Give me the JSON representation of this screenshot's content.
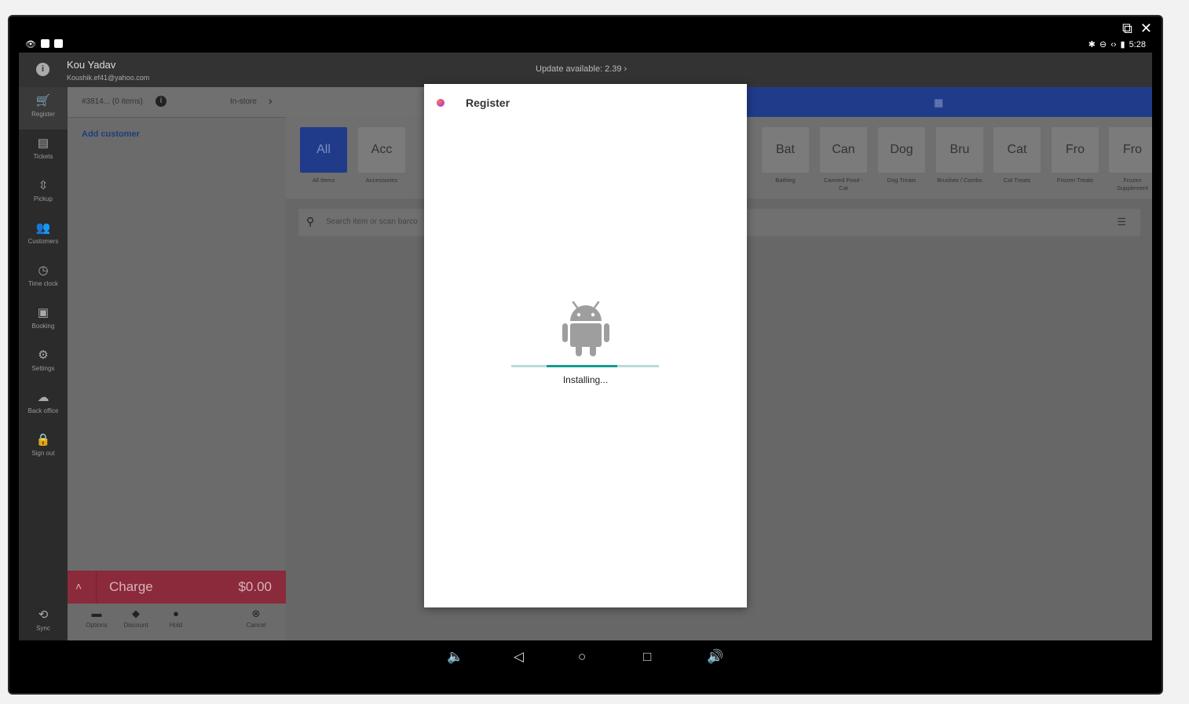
{
  "window": {
    "popout_icon": "popout-icon",
    "close_icon": "close-icon"
  },
  "statusbar": {
    "time": "5:28"
  },
  "header": {
    "user_name": "Kou Yadav",
    "user_email": "Koushik.ef41@yahoo.com",
    "update_text": "Update available: 2.39 ›"
  },
  "sidebar": {
    "items": [
      {
        "label": "Register",
        "icon": "🛒"
      },
      {
        "label": "Tickets",
        "icon": "▤"
      },
      {
        "label": "Pickup",
        "icon": "⇳"
      },
      {
        "label": "Customers",
        "icon": "👥"
      },
      {
        "label": "Time clock",
        "icon": "◷"
      },
      {
        "label": "Booking",
        "icon": "▣"
      },
      {
        "label": "Settings",
        "icon": "⚙"
      },
      {
        "label": "Back office",
        "icon": "☁"
      },
      {
        "label": "Sign out",
        "icon": "🔒"
      }
    ],
    "sync_label": "Sync"
  },
  "order": {
    "number": "#3814... (0 items)",
    "mode": "In-store",
    "add_customer": "Add customer",
    "charge_label": "Charge",
    "charge_amount": "$0.00",
    "actions": [
      {
        "label": "Options"
      },
      {
        "label": "Discount"
      },
      {
        "label": "Hold"
      },
      {
        "label": "Cancel"
      }
    ]
  },
  "categories": [
    {
      "tile": "All",
      "label": "All Items"
    },
    {
      "tile": "Acc",
      "label": "Accessories"
    },
    {
      "tile": "Bat",
      "label": "Bathing"
    },
    {
      "tile": "Can",
      "label": "Canned Food - Cat"
    },
    {
      "tile": "Dog",
      "label": "Dog Treats"
    },
    {
      "tile": "Bru",
      "label": "Brushes / Combs"
    },
    {
      "tile": "Cat",
      "label": "Cat Treats"
    },
    {
      "tile": "Fro",
      "label": "Frozen Treats"
    },
    {
      "tile": "Fro",
      "label": "Frozen Supplement"
    }
  ],
  "search": {
    "placeholder": "Search item or scan barco"
  },
  "dialog": {
    "title": "Register",
    "status": "Installing...",
    "progress": 0.48
  }
}
